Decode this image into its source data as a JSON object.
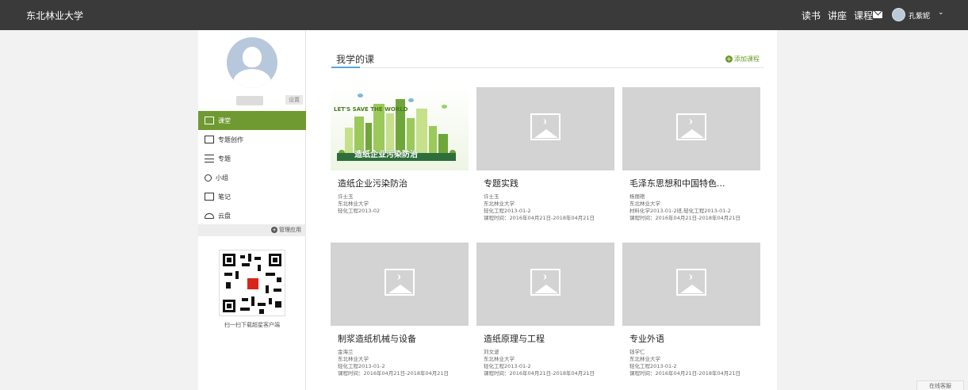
{
  "header": {
    "school_name": "东北林业大学",
    "nav": [
      "读书",
      "讲座",
      "课程"
    ],
    "username": "孔紫妮"
  },
  "sidebar": {
    "settings_label": "设置",
    "menu": [
      {
        "label": "课堂",
        "icon": "classroom-icon",
        "active": true
      },
      {
        "label": "专题创作",
        "icon": "topic-creation-icon",
        "active": false
      },
      {
        "label": "专题",
        "icon": "topic-icon",
        "active": false
      },
      {
        "label": "小组",
        "icon": "group-icon",
        "active": false
      },
      {
        "label": "笔记",
        "icon": "note-icon",
        "active": false
      },
      {
        "label": "云盘",
        "icon": "cloud-icon",
        "active": false
      }
    ],
    "manage_label": "管理应用",
    "qr_caption": "扫一扫下载超星客户端"
  },
  "main": {
    "title": "我学的课",
    "add_course_label": "添加课程",
    "courses": [
      {
        "title": "造纸企业污染防治",
        "teacher": "许士玉",
        "school": "东北林业大学",
        "classes": "轻化工程2013-02",
        "period": "",
        "cover_caption": "造纸企业污染防治",
        "cover_tagline": "LET'S SAVE THE WORLD"
      },
      {
        "title": "专题实践",
        "teacher": "许士玉",
        "school": "东北林业大学",
        "classes": "轻化工程2013-01-2",
        "period": "课程时间：2016年04月21日-2018年04月21日"
      },
      {
        "title": "毛泽东思想和中国特色...",
        "teacher": "杨丽艳",
        "school": "东北林业大学",
        "classes": "材料化学2013-01-2班,轻化工程2013-01-2",
        "period": "课程时间：2016年04月21日-2018年04月21日"
      },
      {
        "title": "制浆造纸机械与设备",
        "teacher": "金海兰",
        "school": "东北林业大学",
        "classes": "轻化工程2013-01-2",
        "period": "课程时间：2016年04月21日-2018年04月21日"
      },
      {
        "title": "造纸原理与工程",
        "teacher": "刘文波",
        "school": "东北林业大学",
        "classes": "轻化工程2013-01-2",
        "period": "课程时间：2016年04月21日-2018年04月21日"
      },
      {
        "title": "专业外语",
        "teacher": "钱学仁",
        "school": "东北林业大学",
        "classes": "轻化工程2013-01-2",
        "period": "课程时间：2016年04月21日-2018年04月21日"
      }
    ]
  },
  "footer": {
    "scroll_tab_label": "在线客服"
  },
  "colors": {
    "topbar": "#3a3a3a",
    "accent_green": "#6f9a31",
    "placeholder_gray": "#d3d3d3",
    "tab_underline": "#56a8d9"
  }
}
